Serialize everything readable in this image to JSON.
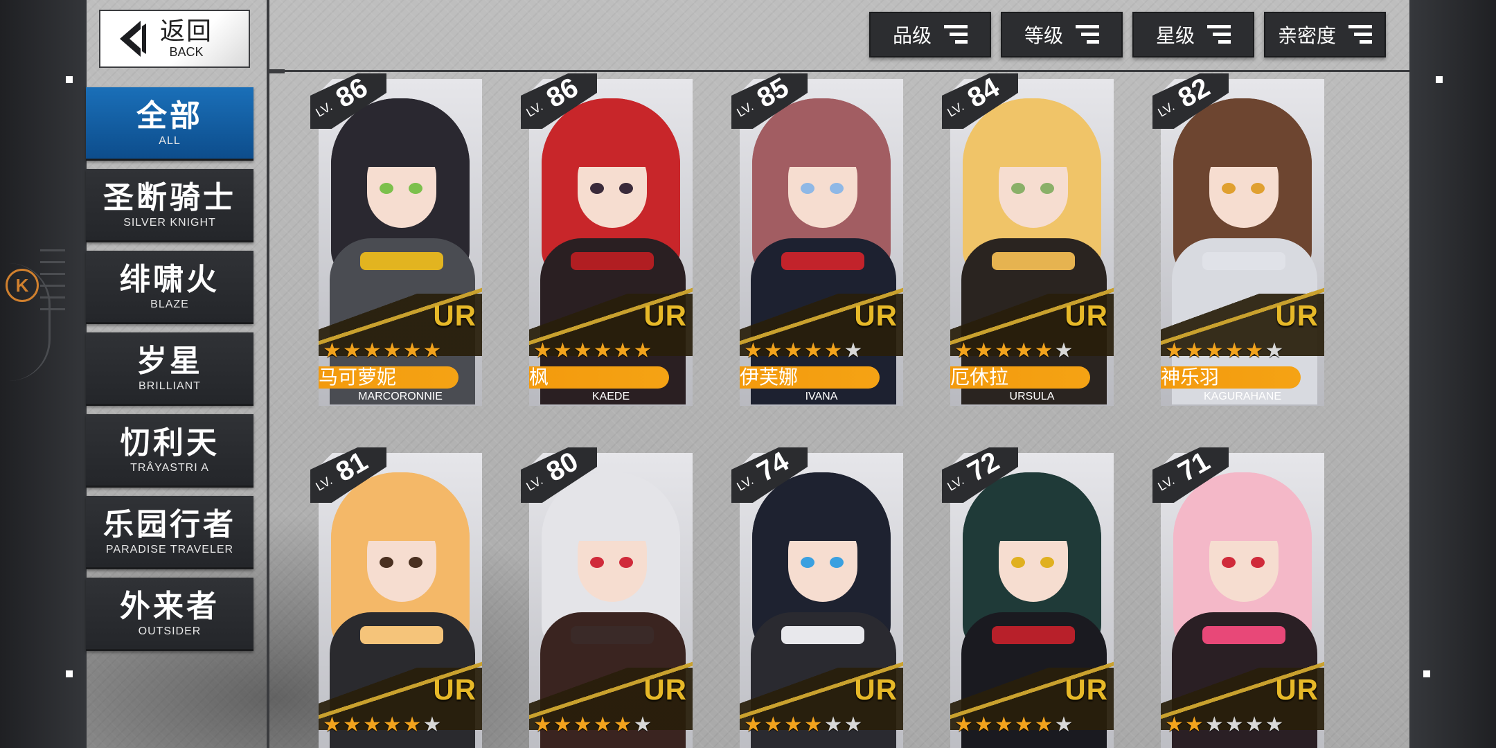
{
  "back": {
    "cn": "返回",
    "en": "BACK"
  },
  "nav": [
    {
      "cn": "全部",
      "en": "ALL",
      "active": true
    },
    {
      "cn": "圣断骑士",
      "en": "SILVER KNIGHT"
    },
    {
      "cn": "绯啸火",
      "en": "BLAZE"
    },
    {
      "cn": "岁星",
      "en": "BRILLIANT"
    },
    {
      "cn": "忉利天",
      "en": "TRÂYASTRI A"
    },
    {
      "cn": "乐园行者",
      "en": "PARADISE TRAVELER"
    },
    {
      "cn": "外来者",
      "en": "OUTSIDER"
    }
  ],
  "sort": [
    {
      "label": "品级",
      "icon": "sort-icon"
    },
    {
      "label": "等级",
      "icon": "sort-icon"
    },
    {
      "label": "星级",
      "icon": "sort-icon"
    },
    {
      "label": "亲密度",
      "icon": "sort-icon"
    }
  ],
  "lv_prefix": "LV.",
  "rarity": "UR",
  "characters": [
    {
      "level": "86",
      "stars": 6,
      "max_stars": 6,
      "cn": "马可萝妮",
      "en": "MARCORONNIE",
      "hair": "#2a2830",
      "accent": "#e2b420",
      "eye": "#7cc04c",
      "outfit": "#4a4c52"
    },
    {
      "level": "86",
      "stars": 6,
      "max_stars": 6,
      "cn": "枫",
      "en": "KAEDE",
      "hair": "#c8262a",
      "accent": "#b11e22",
      "eye": "#3a2a3a",
      "outfit": "#2a1f22"
    },
    {
      "level": "85",
      "stars": 5,
      "max_stars": 6,
      "cn": "伊芙娜",
      "en": "IVANA",
      "hair": "#a25d62",
      "accent": "#c2232b",
      "eye": "#8fb8e6",
      "outfit": "#1d2130"
    },
    {
      "level": "84",
      "stars": 5,
      "max_stars": 6,
      "cn": "厄休拉",
      "en": "URSULA",
      "hair": "#f0c468",
      "accent": "#e6b350",
      "eye": "#8ab068",
      "outfit": "#2a2420"
    },
    {
      "level": "82",
      "stars": 5,
      "max_stars": 6,
      "cn": "神乐羽",
      "en": "KAGURAHANE",
      "hair": "#6d4530",
      "accent": "#e0e2e8",
      "eye": "#e0a030",
      "outfit": "#d8dae0"
    },
    {
      "level": "81",
      "stars": 5,
      "max_stars": 6,
      "hair": "#f4b868",
      "accent": "#f5c47a",
      "eye": "#4a3020",
      "outfit": "#2a2a2e"
    },
    {
      "level": "80",
      "stars": 5,
      "max_stars": 6,
      "hair": "#e4e4e8",
      "accent": "#3a2a28",
      "eye": "#d02a3a",
      "outfit": "#3a2420"
    },
    {
      "level": "74",
      "stars": 4,
      "max_stars": 6,
      "hair": "#1e2230",
      "accent": "#e8e8ec",
      "eye": "#3aa0e0",
      "outfit": "#2a2a30"
    },
    {
      "level": "72",
      "stars": 5,
      "max_stars": 6,
      "hair": "#1f3a38",
      "accent": "#b8202a",
      "eye": "#e0b020",
      "outfit": "#1a1a20"
    },
    {
      "level": "71",
      "stars": 2,
      "max_stars": 6,
      "hair": "#f4b8c8",
      "accent": "#e84878",
      "eye": "#d02a3a",
      "outfit": "#2a1f24"
    }
  ]
}
